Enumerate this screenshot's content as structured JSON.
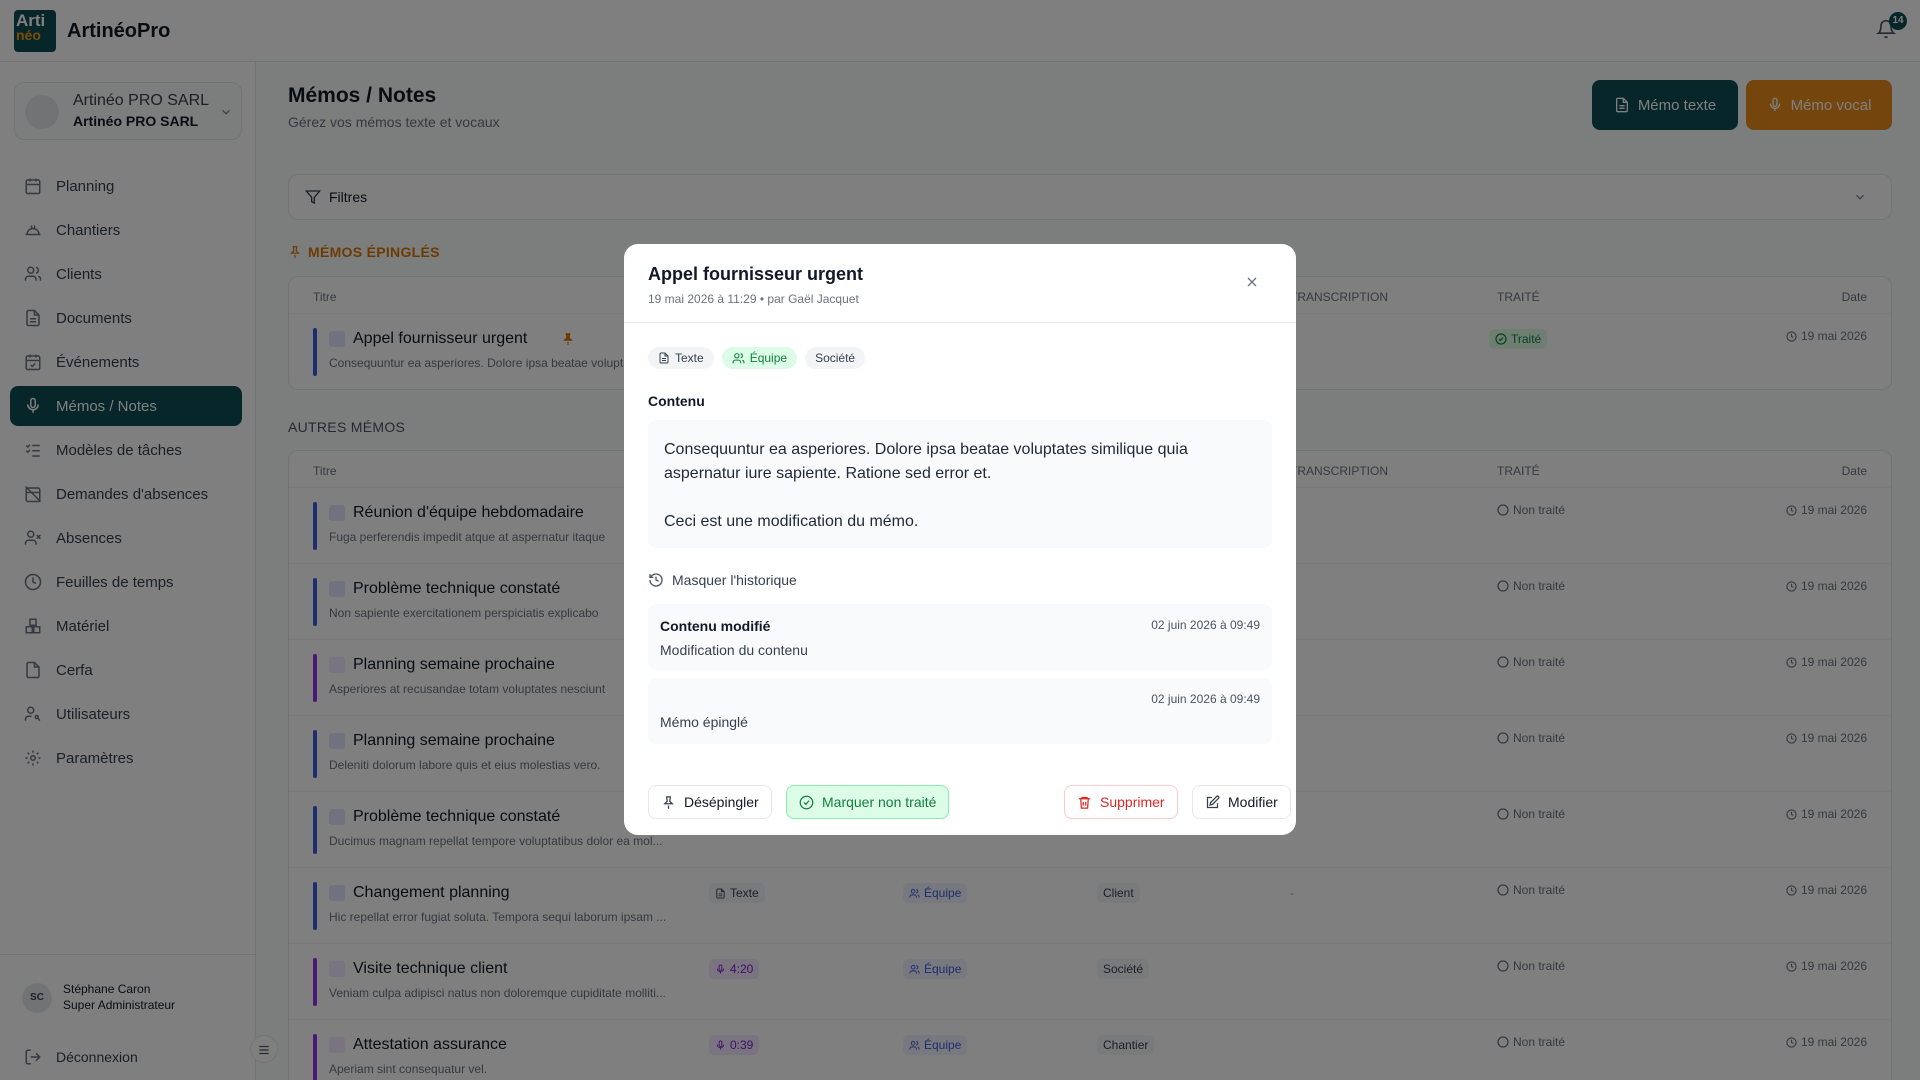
{
  "app": {
    "name": "ArtinéoPro",
    "logo_line1": "Arti",
    "logo_line2": "néo",
    "notif_count": "14"
  },
  "company": {
    "name": "Artinéo PRO SARL",
    "subname": "Artinéo PRO SARL"
  },
  "nav": [
    {
      "label": "Planning",
      "icon": "calendar-icon"
    },
    {
      "label": "Chantiers",
      "icon": "helmet-icon"
    },
    {
      "label": "Clients",
      "icon": "users-icon"
    },
    {
      "label": "Documents",
      "icon": "document-icon"
    },
    {
      "label": "Événements",
      "icon": "calendar-check-icon"
    },
    {
      "label": "Mémos / Notes",
      "icon": "microphone-icon",
      "active": true
    },
    {
      "label": "Modèles de tâches",
      "icon": "list-checks-icon"
    },
    {
      "label": "Demandes d'absences",
      "icon": "calendar-off-icon"
    },
    {
      "label": "Absences",
      "icon": "user-x-icon"
    },
    {
      "label": "Feuilles de temps",
      "icon": "clock-icon"
    },
    {
      "label": "Matériel",
      "icon": "boxes-icon"
    },
    {
      "label": "Cerfa",
      "icon": "file-icon"
    },
    {
      "label": "Utilisateurs",
      "icon": "user-key-icon"
    },
    {
      "label": "Paramètres",
      "icon": "gear-icon"
    }
  ],
  "user": {
    "initials": "SC",
    "name": "Stéphane Caron",
    "role": "Super Administrateur",
    "logout": "Déconnexion"
  },
  "page": {
    "title": "Mémos / Notes",
    "subtitle": "Gérez vos mémos texte et vocaux",
    "btn_text": "Mémo texte",
    "btn_voice": "Mémo vocal",
    "filters": "Filtres"
  },
  "pinned": {
    "heading": "MÉMOS ÉPINGLÉS"
  },
  "others": {
    "heading": "AUTRES MÉMOS"
  },
  "columns": {
    "title": "Titre",
    "transcription": "TRANSCRIPTION",
    "traite": "TRAITÉ",
    "date": "Date"
  },
  "pinned_rows": [
    {
      "title": "Appel fournisseur urgent",
      "desc": "Consequuntur ea asperiores. Dolore ipsa beatae voluptates similique quia",
      "kind": "text",
      "status": "Traité",
      "date": "19 mai 2026"
    }
  ],
  "rows": [
    {
      "title": "Réunion d'équipe hebdomadaire",
      "desc": "Fuga perferendis impedit atque at aspernatur itaque",
      "kind": "text",
      "status": "Non traité",
      "date": "19 mai 2026"
    },
    {
      "title": "Problème technique constaté",
      "desc": "Non sapiente exercitationem perspiciatis explicabo",
      "kind": "text",
      "status": "Non traité",
      "date": "19 mai 2026"
    },
    {
      "title": "Planning semaine prochaine",
      "desc": "Asperiores at recusandae totam voluptates nesciunt",
      "kind": "voice",
      "status": "Non traité",
      "date": "19 mai 2026"
    },
    {
      "title": "Planning semaine prochaine",
      "desc": "Deleniti dolorum labore quis et eius molestias vero.",
      "kind": "text",
      "status": "Non traité",
      "date": "19 mai 2026"
    },
    {
      "title": "Problème technique constaté",
      "desc": "Ducimus magnam repellat tempore voluptatibus dolor ea mol...",
      "kind": "text",
      "status": "Non traité",
      "date": "19 mai 2026"
    },
    {
      "title": "Changement planning",
      "desc": "Hic repellat error fugiat soluta. Tempora sequi laborum ipsam ...",
      "kind": "text",
      "type": "Texte",
      "vis": "Équipe",
      "dest": "Client",
      "trans": "-",
      "status": "Non traité",
      "date": "19 mai 2026"
    },
    {
      "title": "Visite technique client",
      "desc": "Veniam culpa adipisci natus non doloremque cupiditate molliti...",
      "kind": "voice",
      "type": "4:20",
      "vis": "Équipe",
      "dest": "Société",
      "status": "Non traité",
      "date": "19 mai 2026"
    },
    {
      "title": "Attestation assurance",
      "desc": "Aperiam sint consequatur vel.",
      "kind": "voice",
      "type": "0:39",
      "vis": "Équipe",
      "dest": "Chantier",
      "status": "Non traité",
      "date": "19 mai 2026"
    }
  ],
  "modal": {
    "title": "Appel fournisseur urgent",
    "subtitle": "19 mai 2026 à 11:29 • par Gaël Jacquet",
    "badges": {
      "type": "Texte",
      "visibility": "Équipe",
      "target": "Société"
    },
    "content_label": "Contenu",
    "content_p1": "Consequuntur ea asperiores. Dolore ipsa beatae voluptates similique quia aspernatur iure sapiente. Ratione sed error et.",
    "content_p2": "Ceci est une modification du mémo.",
    "history_toggle": "Masquer l'historique",
    "history": [
      {
        "title": "Contenu modifié",
        "detail": "Modification du contenu",
        "date": "02 juin 2026 à 09:49"
      },
      {
        "title": "",
        "detail": "Mémo épinglé",
        "date": "02 juin 2026 à 09:49"
      }
    ],
    "buttons": {
      "unpin": "Désépingler",
      "mark": "Marquer non traité",
      "delete": "Supprimer",
      "edit": "Modifier"
    }
  },
  "colors": {
    "primary": "#0f4c55",
    "accent": "#ea8a1c",
    "danger": "#dc2626",
    "success": "#15803d"
  }
}
